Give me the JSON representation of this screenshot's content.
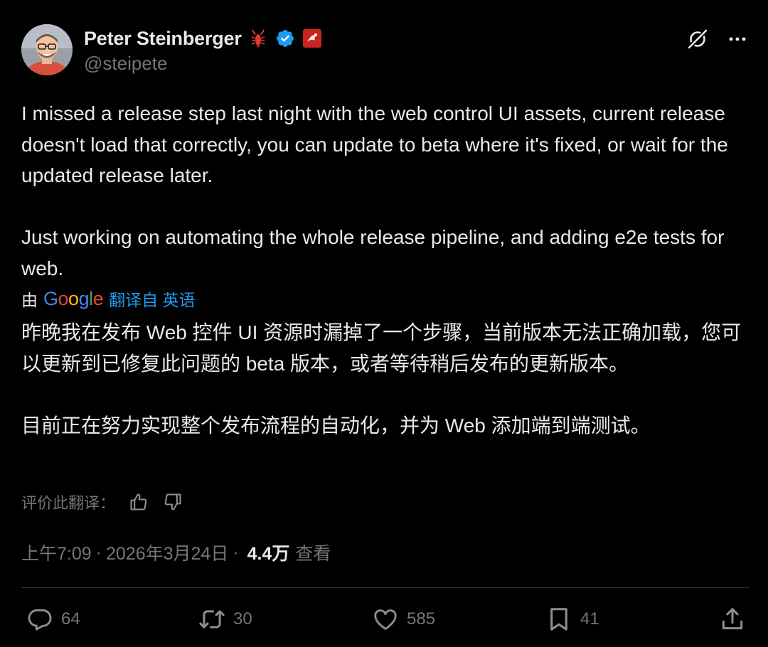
{
  "author": {
    "display_name": "Peter Steinberger",
    "handle": "@steipete",
    "badges": [
      "lobster-emoji-icon",
      "verified-badge-icon",
      "affiliate-badge-icon"
    ],
    "verified_color": "#1d9bf0"
  },
  "header_actions": [
    "grok-icon",
    "more-icon"
  ],
  "tweet": {
    "paragraphs": [
      "I missed a release step last night with the web control UI assets, current release doesn't load that correctly, you can update to beta where it's fixed, or wait for the updated release later.",
      "Just working on automating the whole release pipeline, and adding e2e tests for web."
    ]
  },
  "translation": {
    "by_label": "由",
    "provider": "Google",
    "from_label": "翻译自 英语",
    "paragraphs": [
      "昨晚我在发布 Web 控件 UI 资源时漏掉了一个步骤，当前版本无法正确加载，您可以更新到已修复此问题的 beta 版本，或者等待稍后发布的更新版本。",
      "目前正在努力实现整个发布流程的自动化，并为 Web 添加端到端测试。"
    ],
    "rate_label": "评价此翻译："
  },
  "meta": {
    "time": "上午7:09",
    "separator": "·",
    "date": "2026年3月24日",
    "views_count": "4.4万",
    "views_label": "查看"
  },
  "stats": {
    "replies": "64",
    "reposts": "30",
    "likes": "585",
    "bookmarks": "41"
  },
  "colors": {
    "background": "#000000",
    "text": "#e7e9ea",
    "secondary": "#71767b",
    "accent": "#1d9bf0",
    "divider": "#2f3336"
  }
}
